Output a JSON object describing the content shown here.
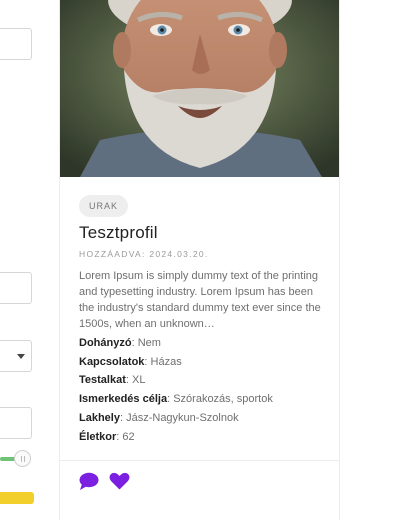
{
  "card": {
    "image_alt": "Portrait of an older man with a grey beard",
    "category_badge": "URAK",
    "title": "Tesztprofil",
    "added": "HOZZÁADVA: 2024.03.20.",
    "description": "Lorem Ipsum is simply dummy text of the printing and typesetting industry. Lorem Ipsum has been the industry's standard dummy text ever since the 1500s, when an unknown…",
    "fields": [
      {
        "label": "Dohányzó",
        "value": "Nem"
      },
      {
        "label": "Kapcsolatok",
        "value": "Házas"
      },
      {
        "label": "Testalkat",
        "value": "XL"
      },
      {
        "label": "Ismerkedés célja",
        "value": "Szórakozás, sportok"
      },
      {
        "label": "Lakhely",
        "value": "Jász-Nagykun-Szolnok"
      },
      {
        "label": "Életkor",
        "value": "62"
      }
    ],
    "actions": [
      {
        "icon": "chat-bubble-icon",
        "color": "#7b1fe0"
      },
      {
        "icon": "heart-icon",
        "color": "#7b1fe0"
      }
    ]
  },
  "sidebar": {
    "slider_color": "#6fc276",
    "button_color": "#f2cf2a"
  }
}
